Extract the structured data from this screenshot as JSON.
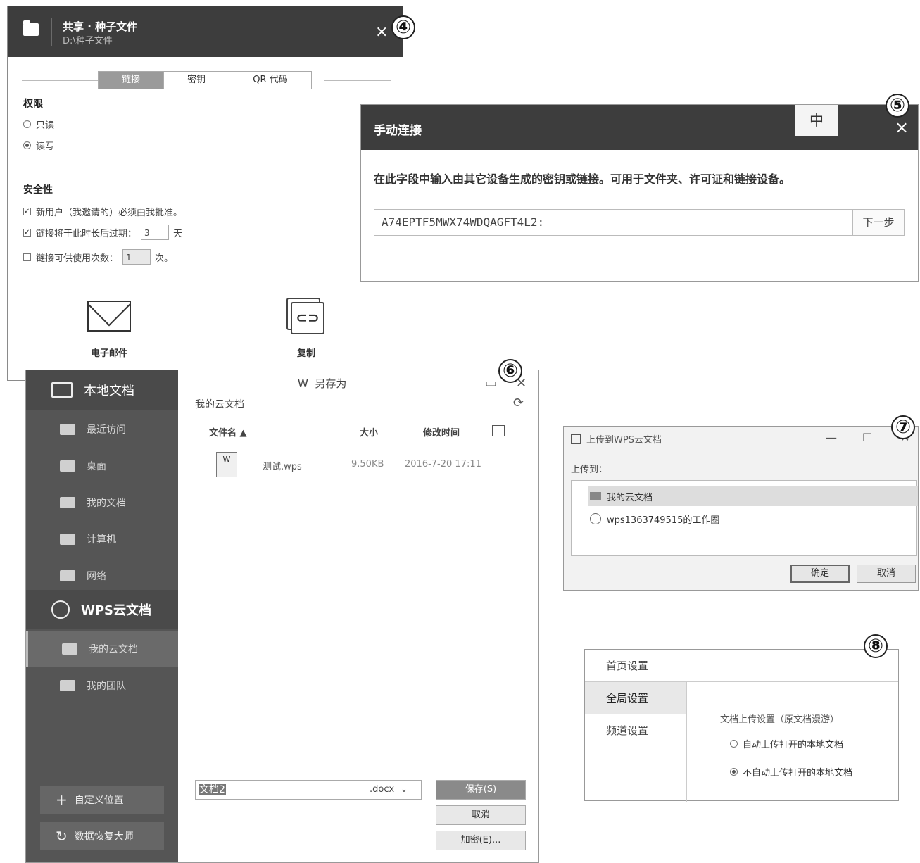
{
  "markers": [
    "④",
    "⑤",
    "⑥",
    "⑦",
    "⑧"
  ],
  "panel4": {
    "title": "共享 · 种子文件",
    "subtitle": "D:\\种子文件",
    "close": "×",
    "tabs": [
      "链接",
      "密钥",
      "QR 代码"
    ],
    "permissions_label": "权限",
    "perm_options": [
      "只读",
      "读写"
    ],
    "security_label": "安全性",
    "security_options": {
      "approve": "新用户（我邀请的）必须由我批准。",
      "expire_prefix": "链接将于此时长后过期：",
      "expire_value": "3",
      "expire_unit": "天",
      "uses_prefix": "链接可供使用次数：",
      "uses_value": "1",
      "uses_unit": "次。"
    },
    "email_label": "电子邮件",
    "copy_label": "复制"
  },
  "panel5": {
    "title": "手动连接",
    "ime": "中",
    "close": "×",
    "description": "在此字段中输入由其它设备生成的密钥或链接。可用于文件夹、许可证和链接设备。",
    "input_value": "A74EPTF5MWX74WDQAGFT4L2:",
    "next_label": "下一步"
  },
  "panel6": {
    "window_title": "另存为",
    "sidebar": {
      "local_docs": "本地文档",
      "local_items": [
        "最近访问",
        "桌面",
        "我的文档",
        "计算机",
        "网络"
      ],
      "cloud_docs": "WPS云文档",
      "cloud_items": [
        "我的云文档",
        "我的团队"
      ],
      "custom_location": "自定义位置",
      "data_recovery": "数据恢复大师"
    },
    "location": "我的云文档",
    "columns": {
      "name": "文件名 ▲",
      "size": "大小",
      "modified": "修改时间"
    },
    "files": [
      {
        "name": "测试.wps",
        "size": "9.50KB",
        "modified": "2016-7-20 17:11"
      }
    ],
    "filename_value": "文档2",
    "filetype": ".docx",
    "buttons": {
      "save": "保存(S)",
      "cancel": "取消",
      "encrypt": "加密(E)..."
    }
  },
  "panel7": {
    "title": "上传到WPS云文档",
    "upload_to_label": "上传到：",
    "tree_items": [
      "我的云文档",
      "wps1363749515的工作圈"
    ],
    "ok": "确定",
    "cancel": "取消"
  },
  "panel8": {
    "nav": [
      "首页设置",
      "全局设置",
      "频道设置"
    ],
    "group_label": "文档上传设置（原文档漫游）",
    "options": [
      "自动上传打开的本地文档",
      "不自动上传打开的本地文档"
    ]
  }
}
